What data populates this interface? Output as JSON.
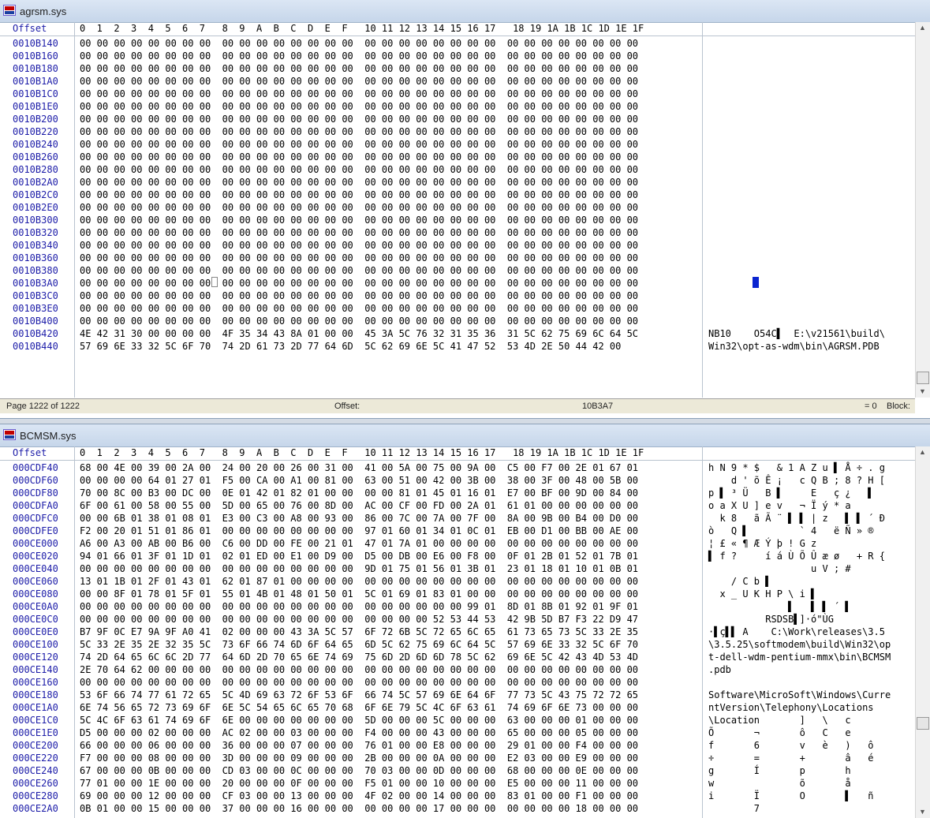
{
  "top": {
    "title": "agrsm.sys",
    "header_offset": "Offset",
    "header_cols": "0  1  2  3  4  5  6  7   8  9  A  B  C  D  E  F   10 11 12 13 14 15 16 17   18 19 1A 1B 1C 1D 1E 1F",
    "rows": [
      {
        "off": "0010B140",
        "hex": "00 00 00 00 00 00 00 00  00 00 00 00 00 00 00 00  00 00 00 00 00 00 00 00  00 00 00 00 00 00 00 00",
        "asc": ""
      },
      {
        "off": "0010B160",
        "hex": "00 00 00 00 00 00 00 00  00 00 00 00 00 00 00 00  00 00 00 00 00 00 00 00  00 00 00 00 00 00 00 00",
        "asc": ""
      },
      {
        "off": "0010B180",
        "hex": "00 00 00 00 00 00 00 00  00 00 00 00 00 00 00 00  00 00 00 00 00 00 00 00  00 00 00 00 00 00 00 00",
        "asc": ""
      },
      {
        "off": "0010B1A0",
        "hex": "00 00 00 00 00 00 00 00  00 00 00 00 00 00 00 00  00 00 00 00 00 00 00 00  00 00 00 00 00 00 00 00",
        "asc": ""
      },
      {
        "off": "0010B1C0",
        "hex": "00 00 00 00 00 00 00 00  00 00 00 00 00 00 00 00  00 00 00 00 00 00 00 00  00 00 00 00 00 00 00 00",
        "asc": ""
      },
      {
        "off": "0010B1E0",
        "hex": "00 00 00 00 00 00 00 00  00 00 00 00 00 00 00 00  00 00 00 00 00 00 00 00  00 00 00 00 00 00 00 00",
        "asc": ""
      },
      {
        "off": "0010B200",
        "hex": "00 00 00 00 00 00 00 00  00 00 00 00 00 00 00 00  00 00 00 00 00 00 00 00  00 00 00 00 00 00 00 00",
        "asc": ""
      },
      {
        "off": "0010B220",
        "hex": "00 00 00 00 00 00 00 00  00 00 00 00 00 00 00 00  00 00 00 00 00 00 00 00  00 00 00 00 00 00 00 00",
        "asc": ""
      },
      {
        "off": "0010B240",
        "hex": "00 00 00 00 00 00 00 00  00 00 00 00 00 00 00 00  00 00 00 00 00 00 00 00  00 00 00 00 00 00 00 00",
        "asc": ""
      },
      {
        "off": "0010B260",
        "hex": "00 00 00 00 00 00 00 00  00 00 00 00 00 00 00 00  00 00 00 00 00 00 00 00  00 00 00 00 00 00 00 00",
        "asc": ""
      },
      {
        "off": "0010B280",
        "hex": "00 00 00 00 00 00 00 00  00 00 00 00 00 00 00 00  00 00 00 00 00 00 00 00  00 00 00 00 00 00 00 00",
        "asc": ""
      },
      {
        "off": "0010B2A0",
        "hex": "00 00 00 00 00 00 00 00  00 00 00 00 00 00 00 00  00 00 00 00 00 00 00 00  00 00 00 00 00 00 00 00",
        "asc": ""
      },
      {
        "off": "0010B2C0",
        "hex": "00 00 00 00 00 00 00 00  00 00 00 00 00 00 00 00  00 00 00 00 00 00 00 00  00 00 00 00 00 00 00 00",
        "asc": ""
      },
      {
        "off": "0010B2E0",
        "hex": "00 00 00 00 00 00 00 00  00 00 00 00 00 00 00 00  00 00 00 00 00 00 00 00  00 00 00 00 00 00 00 00",
        "asc": ""
      },
      {
        "off": "0010B300",
        "hex": "00 00 00 00 00 00 00 00  00 00 00 00 00 00 00 00  00 00 00 00 00 00 00 00  00 00 00 00 00 00 00 00",
        "asc": ""
      },
      {
        "off": "0010B320",
        "hex": "00 00 00 00 00 00 00 00  00 00 00 00 00 00 00 00  00 00 00 00 00 00 00 00  00 00 00 00 00 00 00 00",
        "asc": ""
      },
      {
        "off": "0010B340",
        "hex": "00 00 00 00 00 00 00 00  00 00 00 00 00 00 00 00  00 00 00 00 00 00 00 00  00 00 00 00 00 00 00 00",
        "asc": ""
      },
      {
        "off": "0010B360",
        "hex": "00 00 00 00 00 00 00 00  00 00 00 00 00 00 00 00  00 00 00 00 00 00 00 00  00 00 00 00 00 00 00 00",
        "asc": ""
      },
      {
        "off": "0010B380",
        "hex": "00 00 00 00 00 00 00 00  00 00 00 00 00 00 00 00  00 00 00 00 00 00 00 00  00 00 00 00 00 00 00 00",
        "asc": ""
      },
      {
        "off": "0010B3A0",
        "hex": "00 00 00 00 00 00 00 00  00 00 00 00 00 00 00 00  00 00 00 00 00 00 00 00  00 00 00 00 00 00 00 00",
        "asc": ""
      },
      {
        "off": "0010B3C0",
        "hex": "00 00 00 00 00 00 00 00  00 00 00 00 00 00 00 00  00 00 00 00 00 00 00 00  00 00 00 00 00 00 00 00",
        "asc": ""
      },
      {
        "off": "0010B3E0",
        "hex": "00 00 00 00 00 00 00 00  00 00 00 00 00 00 00 00  00 00 00 00 00 00 00 00  00 00 00 00 00 00 00 00",
        "asc": ""
      },
      {
        "off": "0010B400",
        "hex": "00 00 00 00 00 00 00 00  00 00 00 00 00 00 00 00  00 00 00 00 00 00 00 00  00 00 00 00 00 00 00 00",
        "asc": ""
      },
      {
        "off": "0010B420",
        "hex": "4E 42 31 30 00 00 00 00  4F 35 34 43 8A 01 00 00  45 3A 5C 76 32 31 35 36  31 5C 62 75 69 6C 64 5C",
        "asc": "NB10    O54C▌  E:\\v21561\\build\\"
      },
      {
        "off": "0010B440",
        "hex": "57 69 6E 33 32 5C 6F 70  74 2D 61 73 2D 77 64 6D  5C 62 69 6E 5C 41 47 52  53 4D 2E 50 44 42 00",
        "asc": "Win32\\opt-as-wdm\\bin\\AGRSM.PDB"
      }
    ],
    "status_page": "Page 1222 of 1222",
    "status_offset_label": "Offset:",
    "status_offset_value": "10B3A7",
    "status_eq": "= 0",
    "status_block": "Block:"
  },
  "bottom": {
    "title": "BCMSM.sys",
    "header_offset": "Offset",
    "header_cols": "0  1  2  3  4  5  6  7   8  9  A  B  C  D  E  F   10 11 12 13 14 15 16 17   18 19 1A 1B 1C 1D 1E 1F",
    "rows": [
      {
        "off": "000CDF40",
        "hex": "68 00 4E 00 39 00 2A 00  24 00 20 00 26 00 31 00  41 00 5A 00 75 00 9A 00  C5 00 F7 00 2E 01 67 01",
        "asc": "h N 9 * $   & 1 A Z u ▌ Å ÷ . g"
      },
      {
        "off": "000CDF60",
        "hex": "00 00 00 00 64 01 27 01  F5 00 CA 00 A1 00 81 00  63 00 51 00 42 00 3B 00  38 00 3F 00 48 00 5B 00",
        "asc": "    d ' õ Ê ¡   c Q B ; 8 ? H ["
      },
      {
        "off": "000CDF80",
        "hex": "70 00 8C 00 B3 00 DC 00  0E 01 42 01 82 01 00 00  00 00 81 01 45 01 16 01  E7 00 BF 00 9D 00 84 00",
        "asc": "p ▌ ³ Ü   B ▌     E   ç ¿   ▌"
      },
      {
        "off": "000CDFA0",
        "hex": "6F 00 61 00 58 00 55 00  5D 00 65 00 76 00 8D 00  AC 00 CF 00 FD 00 2A 01  61 01 00 00 00 00 00 00",
        "asc": "o a X U ] e v   ¬ Ï ý * a"
      },
      {
        "off": "000CDFC0",
        "hex": "00 00 6B 01 38 01 08 01  E3 00 C3 00 A8 00 93 00  86 00 7C 00 7A 00 7F 00  8A 00 9B 00 B4 00 D0 00",
        "asc": "  k 8   ã Ã ¨ ▌ ▌ | z   ▌ ▌ ´ Ð"
      },
      {
        "off": "000CDFE0",
        "hex": "F2 00 20 01 51 01 86 01  00 00 00 00 00 00 00 00  97 01 60 01 34 01 0C 01  EB 00 D1 00 BB 00 AE 00",
        "asc": "ò   Q ▌         ` 4   ë Ñ » ®"
      },
      {
        "off": "000CE000",
        "hex": "A6 00 A3 00 AB 00 B6 00  C6 00 DD 00 FE 00 21 01  47 01 7A 01 00 00 00 00  00 00 00 00 00 00 00 00",
        "asc": "¦ £ « ¶ Æ Ý þ ! G z"
      },
      {
        "off": "000CE020",
        "hex": "94 01 66 01 3F 01 1D 01  02 01 ED 00 E1 00 D9 00  D5 00 DB 00 E6 00 F8 00  0F 01 2B 01 52 01 7B 01",
        "asc": "▌ f ?     í á Ù Õ Û æ ø   + R {"
      },
      {
        "off": "000CE040",
        "hex": "00 00 00 00 00 00 00 00  00 00 00 00 00 00 00 00  9D 01 75 01 56 01 3B 01  23 01 18 01 10 01 0B 01",
        "asc": "                  u V ; #"
      },
      {
        "off": "000CE060",
        "hex": "13 01 1B 01 2F 01 43 01  62 01 87 01 00 00 00 00  00 00 00 00 00 00 00 00  00 00 00 00 00 00 00 00",
        "asc": "    / C b ▌"
      },
      {
        "off": "000CE080",
        "hex": "00 00 8F 01 78 01 5F 01  55 01 4B 01 48 01 50 01  5C 01 69 01 83 01 00 00  00 00 00 00 00 00 00 00",
        "asc": "  x _ U K H P \\ i ▌"
      },
      {
        "off": "000CE0A0",
        "hex": "00 00 00 00 00 00 00 00  00 00 00 00 00 00 00 00  00 00 00 00 00 00 99 01  8D 01 8B 01 92 01 9F 01",
        "asc": "              ▌   ▌ ▌ ´ ▌"
      },
      {
        "off": "000CE0C0",
        "hex": "00 00 00 00 00 00 00 00  00 00 00 00 00 00 00 00  00 00 00 00 52 53 44 53  42 9B 5D B7 F3 22 D9 47",
        "asc": "          RSDSB▌]·ó\"ÙG"
      },
      {
        "off": "000CE0E0",
        "hex": "B7 9F 0C E7 9A 9F A0 41  02 00 00 00 43 3A 5C 57  6F 72 6B 5C 72 65 6C 65  61 73 65 73 5C 33 2E 35",
        "asc": "·▌ç▌▌ A    C:\\Work\\releases\\3.5"
      },
      {
        "off": "000CE100",
        "hex": "5C 33 2E 35 2E 32 35 5C  73 6F 66 74 6D 6F 64 65  6D 5C 62 75 69 6C 64 5C  57 69 6E 33 32 5C 6F 70",
        "asc": "\\3.5.25\\softmodem\\build\\Win32\\op"
      },
      {
        "off": "000CE120",
        "hex": "74 2D 64 65 6C 6C 2D 77  64 6D 2D 70 65 6E 74 69  75 6D 2D 6D 6D 78 5C 62  69 6E 5C 42 43 4D 53 4D",
        "asc": "t-dell-wdm-pentium-mmx\\bin\\BCMSM"
      },
      {
        "off": "000CE140",
        "hex": "2E 70 64 62 00 00 00 00  00 00 00 00 00 00 00 00  00 00 00 00 00 00 00 00  00 00 00 00 00 00 00 00",
        "asc": ".pdb"
      },
      {
        "off": "000CE160",
        "hex": "00 00 00 00 00 00 00 00  00 00 00 00 00 00 00 00  00 00 00 00 00 00 00 00  00 00 00 00 00 00 00 00",
        "asc": ""
      },
      {
        "off": "000CE180",
        "hex": "53 6F 66 74 77 61 72 65  5C 4D 69 63 72 6F 53 6F  66 74 5C 57 69 6E 64 6F  77 73 5C 43 75 72 72 65",
        "asc": "Software\\MicroSoft\\Windows\\Curre"
      },
      {
        "off": "000CE1A0",
        "hex": "6E 74 56 65 72 73 69 6F  6E 5C 54 65 6C 65 70 68  6F 6E 79 5C 4C 6F 63 61  74 69 6F 6E 73 00 00 00",
        "asc": "ntVersion\\Telephony\\Locations"
      },
      {
        "off": "000CE1C0",
        "hex": "5C 4C 6F 63 61 74 69 6F  6E 00 00 00 00 00 00 00  5D 00 00 00 5C 00 00 00  63 00 00 00 01 00 00 00",
        "asc": "\\Location       ]   \\   c"
      },
      {
        "off": "000CE1E0",
        "hex": "D5 00 00 00 02 00 00 00  AC 02 00 00 03 00 00 00  F4 00 00 00 43 00 00 00  65 00 00 00 05 00 00 00",
        "asc": "Õ       ¬       ô   C   e"
      },
      {
        "off": "000CE200",
        "hex": "66 00 00 00 06 00 00 00  36 00 00 00 07 00 00 00  76 01 00 00 E8 00 00 00  29 01 00 00 F4 00 00 00",
        "asc": "f       6       v   è   )   ô"
      },
      {
        "off": "000CE220",
        "hex": "F7 00 00 00 08 00 00 00  3D 00 00 00 09 00 00 00  2B 00 00 00 0A 00 00 00  E2 03 00 00 E9 00 00 00",
        "asc": "÷       =       +       â   é"
      },
      {
        "off": "000CE240",
        "hex": "67 00 00 00 0B 00 00 00  CD 03 00 00 0C 00 00 00  70 03 00 00 0D 00 00 00  68 00 00 00 0E 00 00 00",
        "asc": "g       Í       p       h"
      },
      {
        "off": "000CE260",
        "hex": "77 01 00 00 1E 00 00 00  20 00 00 00 0F 00 00 00  F5 01 00 00 10 00 00 00  E5 00 00 00 11 00 00 00",
        "asc": "w               õ       å"
      },
      {
        "off": "000CE280",
        "hex": "69 00 00 00 12 00 00 00  CF 03 00 00 13 00 00 00  4F 02 00 00 14 00 00 00  83 01 00 00 F1 00 00 00",
        "asc": "i       Ï       O       ▌   ñ"
      },
      {
        "off": "000CE2A0",
        "hex": "0B 01 00 00 15 00 00 00  37 00 00 00 16 00 00 00  00 00 00 00 17 00 00 00  00 00 00 00 18 00 00 00",
        "asc": "        7"
      }
    ]
  }
}
